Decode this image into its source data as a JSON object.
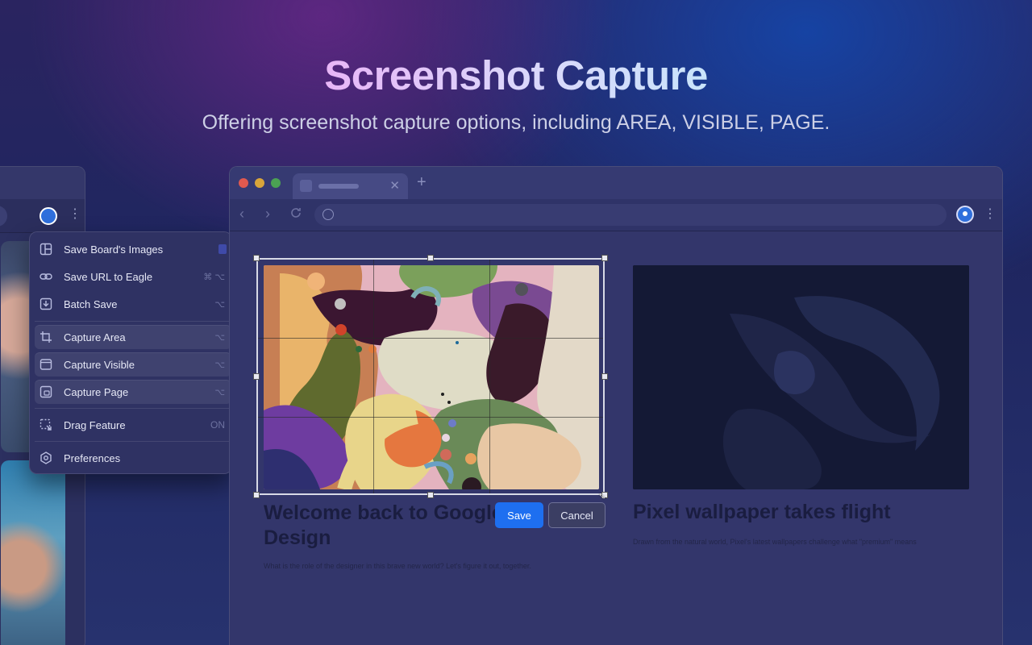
{
  "hero": {
    "title": "Screenshot Capture",
    "subtitle": "Offering screenshot capture options, including AREA, VISIBLE, PAGE."
  },
  "menu": {
    "items": [
      {
        "label": "Save Board's Images",
        "icon": "board-images-icon",
        "shortcut": "",
        "highlighted": false
      },
      {
        "label": "Save URL to Eagle",
        "icon": "link-icon",
        "shortcut": "⌘ ⌥",
        "highlighted": false
      },
      {
        "label": "Batch Save",
        "icon": "batch-save-icon",
        "shortcut": "⌥",
        "highlighted": false
      },
      {
        "label": "Capture Area",
        "icon": "crop-icon",
        "shortcut": "⌥",
        "highlighted": true
      },
      {
        "label": "Capture Visible",
        "icon": "window-icon",
        "shortcut": "⌥",
        "highlighted": true
      },
      {
        "label": "Capture Page",
        "icon": "page-capture-icon",
        "shortcut": "⌥",
        "highlighted": true
      },
      {
        "label": "Drag Feature",
        "icon": "drag-icon",
        "shortcut": "ON",
        "highlighted": false
      },
      {
        "label": "Preferences",
        "icon": "settings-icon",
        "shortcut": "",
        "highlighted": false
      }
    ]
  },
  "page": {
    "article1": {
      "title": "Welcome back to Google Design",
      "summary": "What is the role of the designer in this brave new world? Let's figure it out, together."
    },
    "article2": {
      "title": "Pixel wallpaper takes flight",
      "summary": "Drawn from the natural world, Pixel's latest wallpapers challenge what \"premium\" means"
    }
  },
  "capture": {
    "save_label": "Save",
    "cancel_label": "Cancel"
  },
  "colors": {
    "accent": "#1e6ff0",
    "traffic_red": "#e0594f",
    "traffic_yellow": "#d9a53a",
    "traffic_green": "#4ba153"
  }
}
